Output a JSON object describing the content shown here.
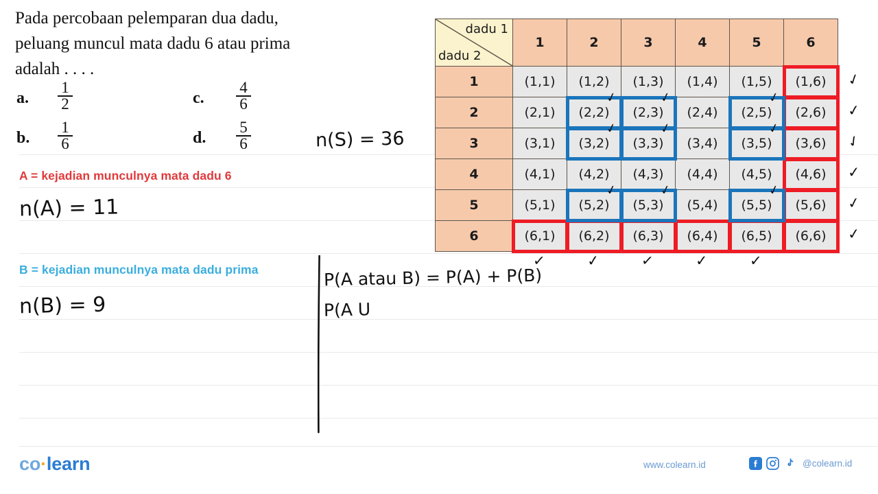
{
  "question": {
    "lines": [
      "Pada percobaan pelemparan dua dadu,",
      "peluang muncul mata dadu 6 atau prima",
      "adalah . . . ."
    ]
  },
  "options": [
    {
      "label": "a.",
      "num": "1",
      "den": "2"
    },
    {
      "label": "b.",
      "num": "1",
      "den": "6"
    },
    {
      "label": "c.",
      "num": "4",
      "den": "6"
    },
    {
      "label": "d.",
      "num": "5",
      "den": "6"
    }
  ],
  "definitions": {
    "a_text": "A = kejadian munculnya mata dadu 6",
    "a_color": "#e03a3c",
    "b_text": "B = kejadian munculnya mata dadu prima",
    "b_color": "#3aaede"
  },
  "handwriting": {
    "n_s": "n(S) = 36",
    "n_a": "n(A) =   11",
    "n_b": "n(B) = 9",
    "formula1": "P(A atau B) =   P(A) + P(B)",
    "formula2": "P(A U"
  },
  "table": {
    "corner": {
      "top_right": "dadu 1",
      "bottom_left": "dadu 2"
    },
    "col_headers": [
      "1",
      "2",
      "3",
      "4",
      "5",
      "6"
    ],
    "row_headers": [
      "1",
      "2",
      "3",
      "4",
      "5",
      "6"
    ],
    "rows": [
      [
        "(1,1)",
        "(1,2)",
        "(1,3)",
        "(1,4)",
        "(1,5)",
        "(1,6)"
      ],
      [
        "(2,1)",
        "(2,2)",
        "(2,3)",
        "(2,4)",
        "(2,5)",
        "(2,6)"
      ],
      [
        "(3,1)",
        "(3,2)",
        "(3,3)",
        "(3,4)",
        "(3,5)",
        "(3,6)"
      ],
      [
        "(4,1)",
        "(4,2)",
        "(4,3)",
        "(4,4)",
        "(4,5)",
        "(4,6)"
      ],
      [
        "(5,1)",
        "(5,2)",
        "(5,3)",
        "(5,4)",
        "(5,5)",
        "(5,6)"
      ],
      [
        "(6,1)",
        "(6,2)",
        "(6,3)",
        "(6,4)",
        "(6,5)",
        "(6,6)"
      ]
    ],
    "header_fill": "#f6c9ab",
    "corner_fill": "#fbf3cd",
    "cell_fill": "#e8e8e8",
    "highlight_red": "#ee1c25",
    "highlight_blue": "#1b75bb",
    "red_cells": [
      "(1,6)",
      "(2,6)",
      "(3,6)",
      "(4,6)",
      "(5,6)",
      "(6,6)",
      "(6,1)",
      "(6,2)",
      "(6,3)",
      "(6,4)",
      "(6,5)"
    ],
    "blue_cells": [
      "(2,2)",
      "(2,3)",
      "(2,5)",
      "(3,2)",
      "(3,3)",
      "(3,5)",
      "(5,2)",
      "(5,3)",
      "(5,5)"
    ],
    "check_mark": "✓"
  },
  "footer": {
    "logo_co": "co",
    "logo_dot": "·",
    "logo_learn": "learn",
    "website": "www.colearn.id",
    "handle": "@colearn.id",
    "brand_color": "#2b7cd3"
  }
}
